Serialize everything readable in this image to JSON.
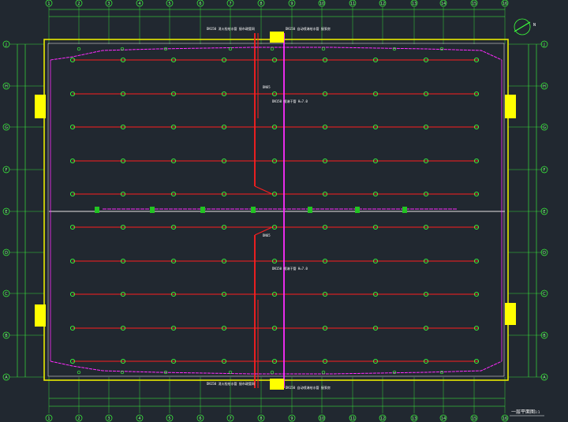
{
  "drawing": {
    "title": "一层平面图",
    "title_scale": "1:1",
    "north_label": "N"
  },
  "grid": {
    "columns": [
      "1",
      "2",
      "3",
      "4",
      "5",
      "6",
      "7",
      "8",
      "9",
      "10",
      "11",
      "12",
      "13",
      "14",
      "15",
      "16"
    ],
    "rows": [
      "J",
      "H",
      "G",
      "F",
      "E",
      "D",
      "C",
      "B",
      "A"
    ]
  },
  "annotations": {
    "top_note_1": "DN150 消火栓给水管 接市政管网",
    "top_note_2": "DN150 自动喷淋给水管 接泵房",
    "bottom_note_1": "DN150 消火栓给水管 接市政管网",
    "bottom_note_2": "DN150 自动喷淋给水管 接泵房",
    "mid_note_1": "DN150 喷淋干管 H=7.0",
    "mid_note_2": "DN150 喷淋干管 H=7.0",
    "pipe_tag": "DN65"
  },
  "colors": {
    "background": "#212830",
    "axis": "#3cff3c",
    "wall": "#e8e800",
    "sprinkler_pipe": "#ff1e1e",
    "hydrant_pipe": "#ff2cff",
    "equipment": "#ffff00",
    "divider": "#bfbfbf"
  }
}
